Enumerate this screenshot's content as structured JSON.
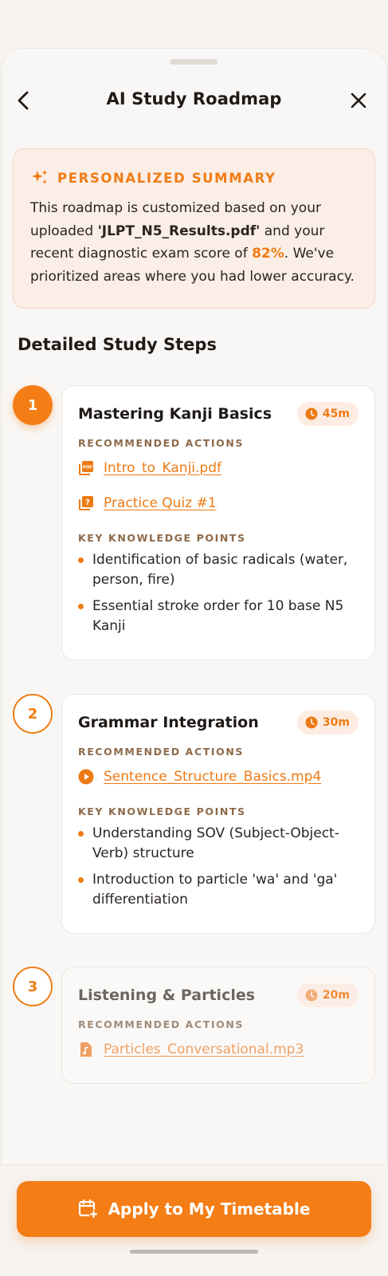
{
  "header": {
    "title": "AI Study Roadmap"
  },
  "summary": {
    "heading": "PERSONALIZED SUMMARY",
    "text_1": "This roadmap is customized based on your uploaded ",
    "file": "'JLPT_N5_Results.pdf'",
    "text_2": " and your recent diagnostic exam score of ",
    "score": "82%",
    "text_3": ". We've prioritized areas where you had lower accuracy."
  },
  "section_title": "Detailed Study Steps",
  "steps": [
    {
      "number": "1",
      "title": "Mastering Kanji Basics",
      "duration": "45m",
      "actions_label": "RECOMMENDED ACTIONS",
      "actions": [
        {
          "icon": "pdf-icon",
          "label": "Intro_to_Kanji.pdf"
        },
        {
          "icon": "quiz-icon",
          "label": "Practice Quiz #1"
        }
      ],
      "knowledge_label": "KEY KNOWLEDGE POINTS",
      "points": [
        "Identification of basic radicals (water, person, fire)",
        "Essential stroke order for 10 base N5 Kanji"
      ]
    },
    {
      "number": "2",
      "title": "Grammar Integration",
      "duration": "30m",
      "actions_label": "RECOMMENDED ACTIONS",
      "actions": [
        {
          "icon": "play-circle-icon",
          "label": "Sentence_Structure_Basics.mp4"
        }
      ],
      "knowledge_label": "KEY KNOWLEDGE POINTS",
      "points": [
        "Understanding SOV (Subject-Object-Verb) structure",
        "Introduction to particle 'wa' and 'ga' differentiation"
      ]
    },
    {
      "number": "3",
      "title": "Listening & Particles",
      "duration": "20m",
      "actions_label": "RECOMMENDED ACTIONS",
      "actions": [
        {
          "icon": "audio-file-icon",
          "label": "Particles_Conversational.mp3"
        }
      ]
    }
  ],
  "cta": {
    "label": "Apply to My Timetable"
  },
  "colors": {
    "accent": "#f47d16",
    "summary_bg": "#fbeee6",
    "chip_bg": "#fcece2"
  }
}
